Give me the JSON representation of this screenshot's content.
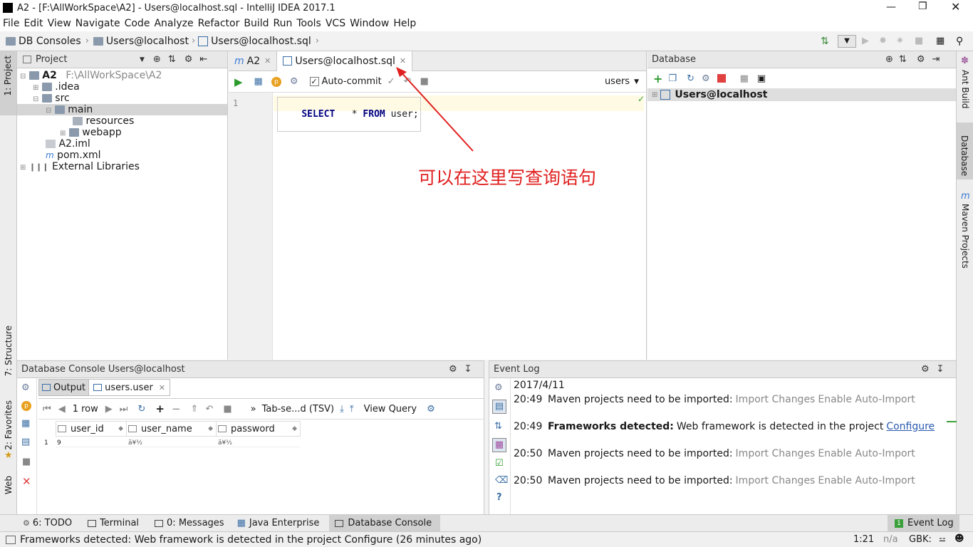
{
  "window": {
    "title": "A2 - [F:\\AllWorkSpace\\A2] - Users@localhost.sql - IntelliJ IDEA 2017.1"
  },
  "menu": [
    "File",
    "Edit",
    "View",
    "Navigate",
    "Code",
    "Analyze",
    "Refactor",
    "Build",
    "Run",
    "Tools",
    "VCS",
    "Window",
    "Help"
  ],
  "breadcrumb": [
    "DB Consoles",
    "Users@localhost",
    "Users@localhost.sql"
  ],
  "project": {
    "header": "Project",
    "root_name": "A2",
    "root_path": "F:\\AllWorkSpace\\A2",
    "items": [
      ".idea",
      "src",
      "main",
      "resources",
      "webapp",
      "A2.iml",
      "pom.xml",
      "External Libraries"
    ]
  },
  "editor": {
    "tabs": [
      "A2",
      "Users@localhost.sql"
    ],
    "autocommit": "Auto-commit",
    "schema": "users",
    "line_number": "1",
    "sql_keyword1": "SELECT",
    "sql_star": "*",
    "sql_keyword2": "FROM",
    "sql_table": "user;"
  },
  "annotation": {
    "text": "可以在这里写查询语句",
    "color": "#e02020"
  },
  "database": {
    "header": "Database",
    "item": "Users@localhost"
  },
  "console": {
    "header": "Database Console Users@localhost",
    "tabs": [
      "Output",
      "users.user"
    ],
    "rows_label": "1 row",
    "tsv_label": "Tab-se...d (TSV)",
    "view_query": "View Query",
    "columns": [
      "user_id",
      "user_name",
      "password"
    ],
    "rows": [
      [
        "1",
        "9",
        "ä¥½",
        "ä¥½"
      ]
    ]
  },
  "eventlog": {
    "header": "Event Log",
    "date": "2017/4/11",
    "entries": [
      {
        "time": "20:49",
        "msg": "Maven projects need to be imported:",
        "link1": "Import Changes",
        "link2": "Enable Auto-Import"
      },
      {
        "time": "20:49",
        "bold": "Frameworks detected:",
        "msg": "Web framework is detected in the project",
        "link1": "Configure"
      },
      {
        "time": "20:50",
        "msg": "Maven projects need to be imported:",
        "link1": "Import Changes",
        "link2": "Enable Auto-Import"
      },
      {
        "time": "20:50",
        "msg": "Maven projects need to be imported:",
        "link1": "Import Changes",
        "link2": "Enable Auto-Import"
      }
    ]
  },
  "left_tools": [
    "1: Project",
    "7: Structure",
    "2: Favorites",
    "Web"
  ],
  "right_tools": [
    "Ant Build",
    "Database",
    "Maven Projects"
  ],
  "bottom_tools": [
    "6: TODO",
    "Terminal",
    "0: Messages",
    "Java Enterprise",
    "Database Console"
  ],
  "event_log_button": "Event Log",
  "status": {
    "message": "Frameworks detected: Web framework is detected in the project Configure (26 minutes ago)",
    "position": "1:21",
    "na": "n/a",
    "encoding": "GBK:"
  }
}
